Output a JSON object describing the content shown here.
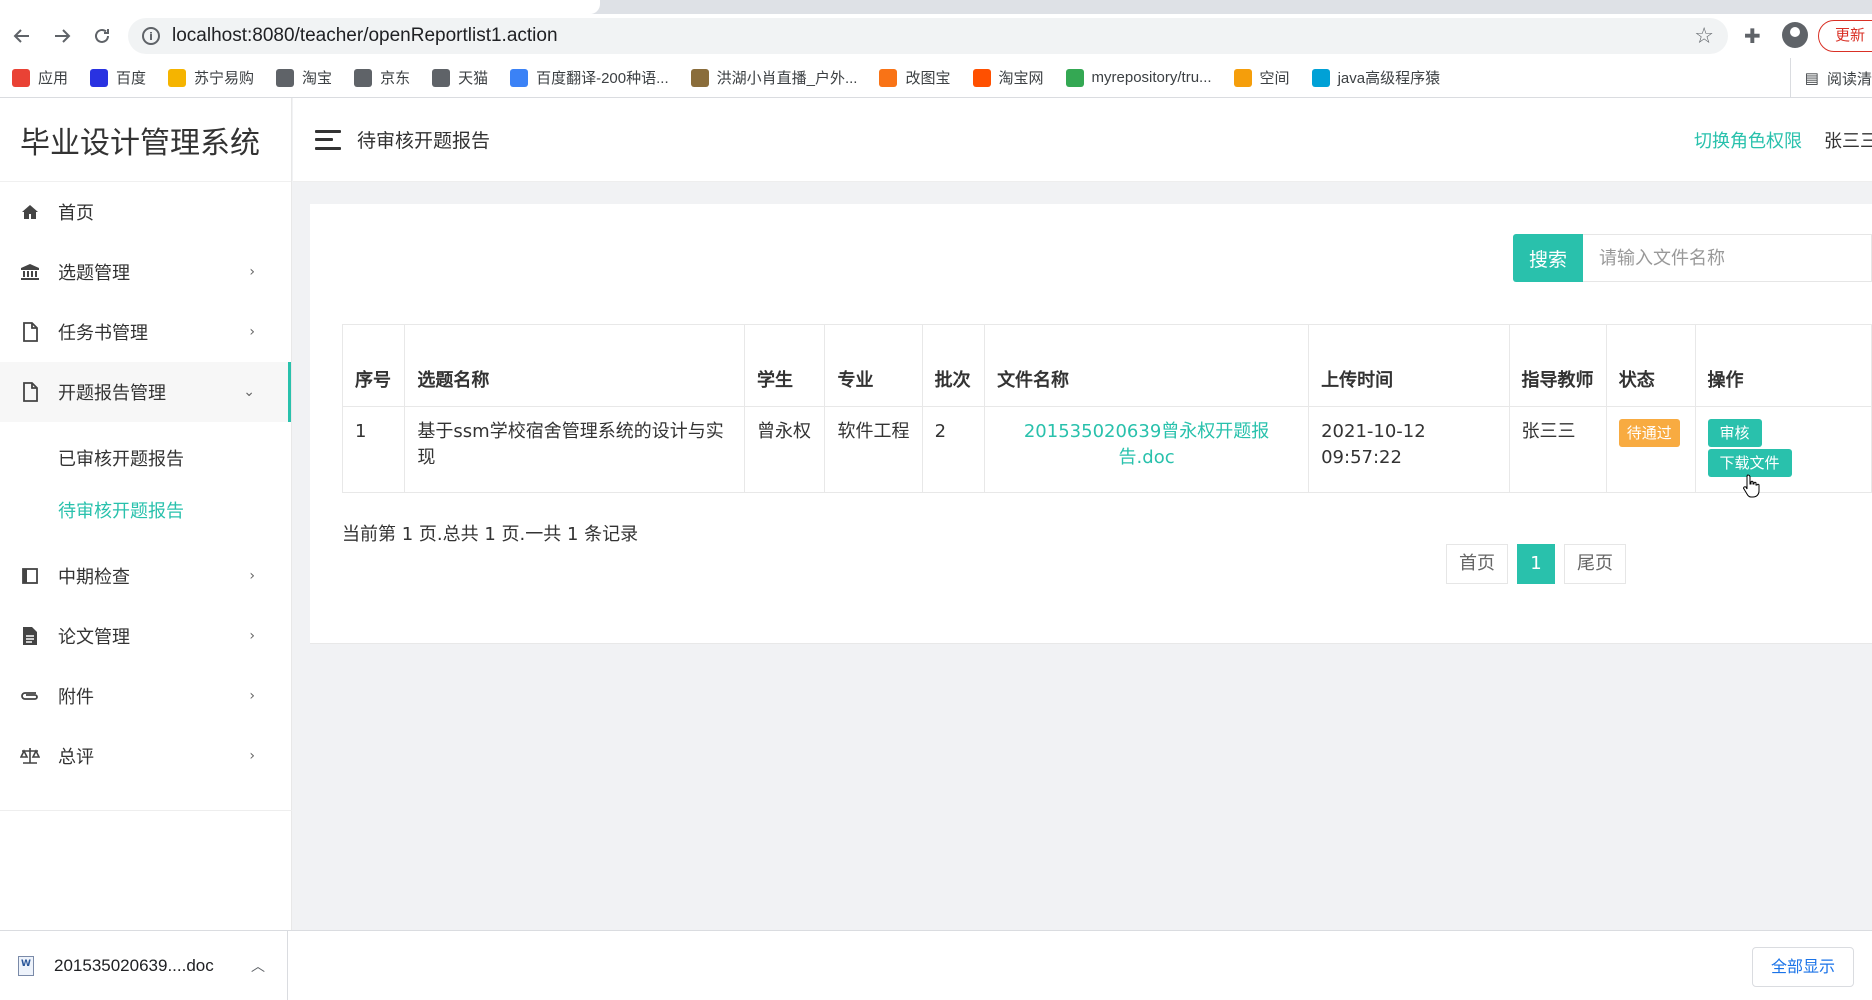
{
  "browser": {
    "url": "localhost:8080/teacher/openReportlist1.action",
    "update_label": "更新",
    "bookmarks": [
      {
        "label": "应用",
        "icon": "apps-grid-icon",
        "color": "#e94235"
      },
      {
        "label": "百度",
        "icon": "baidu-paw-icon",
        "color": "#2932e1"
      },
      {
        "label": "苏宁易购",
        "icon": "suning-icon",
        "color": "#f5b400"
      },
      {
        "label": "淘宝",
        "icon": "globe-icon",
        "color": "#5f6368"
      },
      {
        "label": "京东",
        "icon": "globe-icon",
        "color": "#5f6368"
      },
      {
        "label": "天猫",
        "icon": "globe-icon",
        "color": "#5f6368"
      },
      {
        "label": "百度翻译-200种语...",
        "icon": "translate-icon",
        "color": "#3b82f6"
      },
      {
        "label": "洪湖小肖直播_户外...",
        "icon": "bird-icon",
        "color": "#8a6d3b"
      },
      {
        "label": "改图宝",
        "icon": "gaitubao-icon",
        "color": "#f97316"
      },
      {
        "label": "淘宝网",
        "icon": "taobao-icon",
        "color": "#ff5000"
      },
      {
        "label": "myrepository/tru...",
        "icon": "chrome-icon",
        "color": "#34a853"
      },
      {
        "label": "空间",
        "icon": "qzone-icon",
        "color": "#f59e0b"
      },
      {
        "label": "java高级程序猿",
        "icon": "bilibili-icon",
        "color": "#00a1d6"
      }
    ],
    "reading_list_label": "阅读清"
  },
  "sidebar": {
    "brand": "毕业设计管理系统",
    "items": [
      {
        "label": "首页",
        "icon": "home-icon",
        "has_children": false
      },
      {
        "label": "选题管理",
        "icon": "bank-icon",
        "has_children": true
      },
      {
        "label": "任务书管理",
        "icon": "file-icon",
        "has_children": true
      },
      {
        "label": "开题报告管理",
        "icon": "file-icon",
        "has_children": true,
        "open": true
      },
      {
        "label": "中期检查",
        "icon": "book-icon",
        "has_children": true
      },
      {
        "label": "论文管理",
        "icon": "file-text-icon",
        "has_children": true
      },
      {
        "label": "附件",
        "icon": "paperclip-icon",
        "has_children": true
      },
      {
        "label": "总评",
        "icon": "scale-icon",
        "has_children": true
      }
    ],
    "sub_items": [
      "已审核开题报告",
      "待审核开题报告"
    ],
    "active_sub": "待审核开题报告"
  },
  "header": {
    "title": "待审核开题报告",
    "switch_role": "切换角色权限",
    "user": "张三三"
  },
  "search": {
    "button": "搜索",
    "placeholder": "请输入文件名称"
  },
  "table": {
    "columns": [
      "序号",
      "选题名称",
      "学生",
      "专业",
      "批次",
      "文件名称",
      "上传时间",
      "指导教师",
      "状态",
      "操作"
    ],
    "rows": [
      {
        "index": "1",
        "topic": "基于ssm学校宿舍管理系统的设计与实现",
        "student": "曾永权",
        "major": "软件工程",
        "batch": "2",
        "file": "201535020639曾永权开题报告.doc",
        "upload_time": "2021-10-12 09:57:22",
        "teacher": "张三三",
        "status": "待通过",
        "actions": [
          "审核",
          "下载文件"
        ]
      }
    ]
  },
  "pager": {
    "info": "当前第 1 页.总共 1 页.一共 1 条记录",
    "first": "首页",
    "current": "1",
    "last": "尾页"
  },
  "downloads": {
    "file": "201535020639....doc",
    "show_all": "全部显示"
  },
  "colors": {
    "accent": "#29c1ac",
    "status_pending": "#f8ab41"
  }
}
